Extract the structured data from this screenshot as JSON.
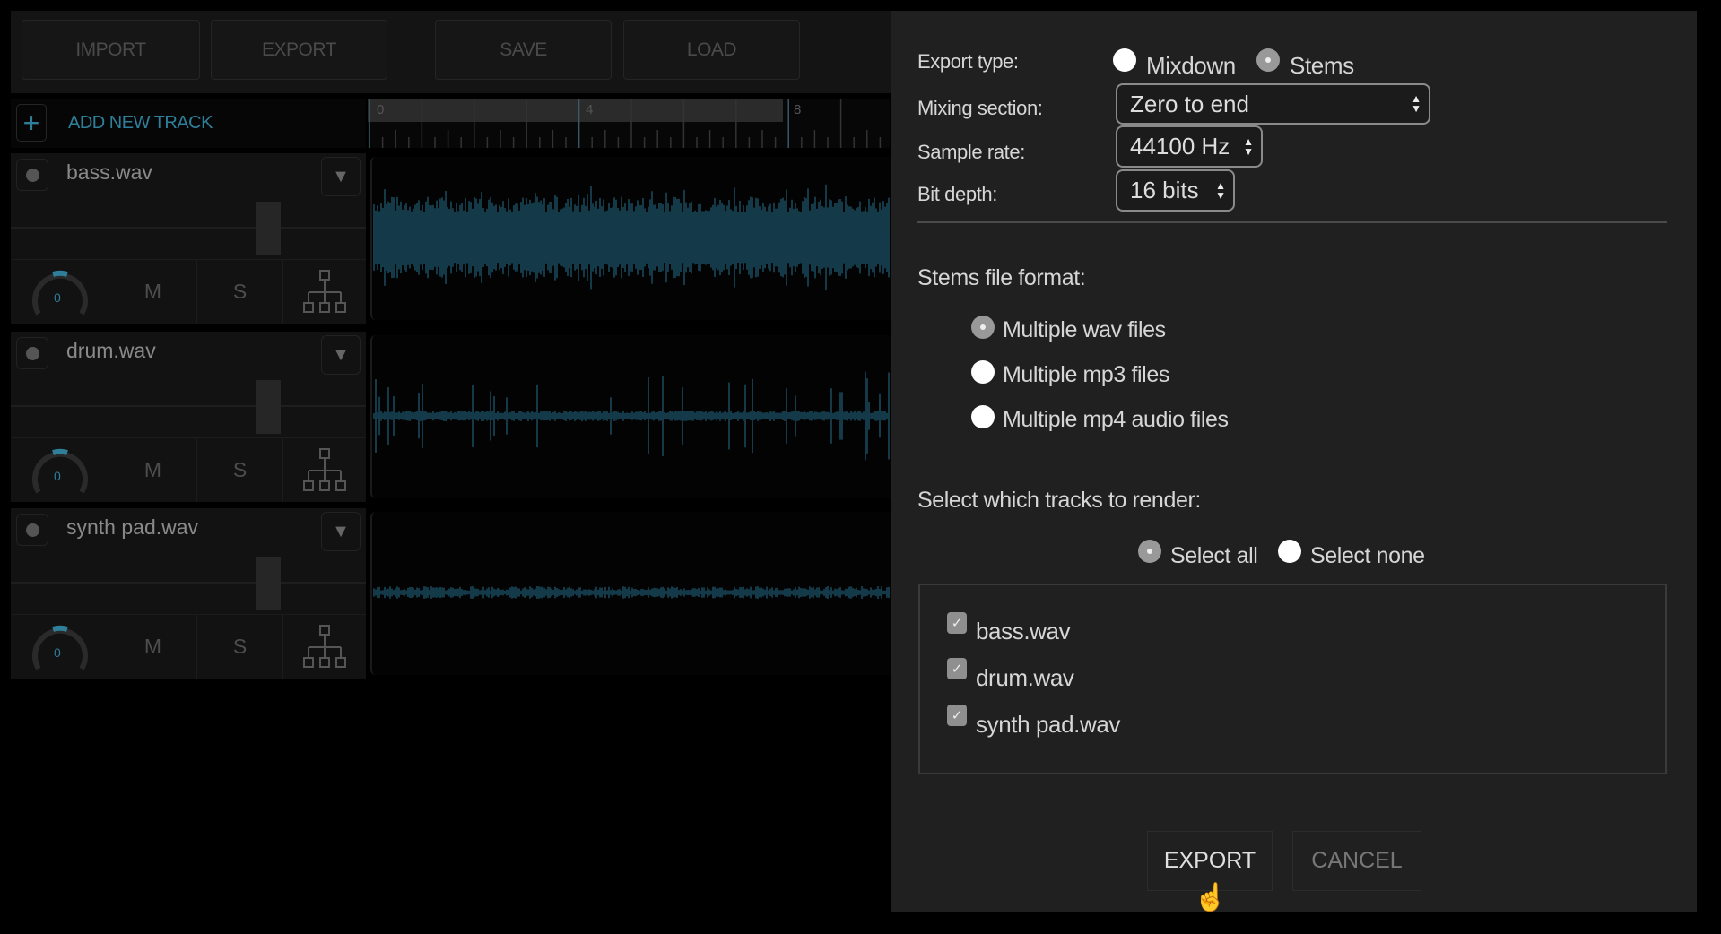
{
  "toolbar": {
    "import": "IMPORT",
    "export": "EXPORT",
    "save": "SAVE",
    "load": "LOAD"
  },
  "add_track": {
    "icon": "plus-icon",
    "label": "ADD NEW TRACK"
  },
  "timeline": {
    "markers": [
      "0",
      "4",
      "8"
    ]
  },
  "accent_color": "#2f7f9a",
  "tracks": [
    {
      "name": "bass.wav",
      "pan": "0",
      "mute": "M",
      "solo": "S"
    },
    {
      "name": "drum.wav",
      "pan": "0",
      "mute": "M",
      "solo": "S"
    },
    {
      "name": "synth pad.wav",
      "pan": "0",
      "mute": "M",
      "solo": "S"
    }
  ],
  "dialog": {
    "export_type_label": "Export type:",
    "export_types": [
      {
        "label": "Mixdown",
        "selected": false
      },
      {
        "label": "Stems",
        "selected": true
      }
    ],
    "mixing_section_label": "Mixing section:",
    "mixing_section_value": "Zero to end",
    "sample_rate_label": "Sample rate:",
    "sample_rate_value": "44100 Hz",
    "bit_depth_label": "Bit depth:",
    "bit_depth_value": "16 bits",
    "stems_format_label": "Stems file format:",
    "stems_formats": [
      {
        "label": "Multiple wav files",
        "selected": true
      },
      {
        "label": "Multiple mp3 files",
        "selected": false
      },
      {
        "label": "Multiple mp4 audio files",
        "selected": false
      }
    ],
    "tracks_label": "Select which tracks to render:",
    "select_all": "Select all",
    "select_none": "Select none",
    "track_checks": [
      {
        "label": "bass.wav",
        "checked": true
      },
      {
        "label": "drum.wav",
        "checked": true
      },
      {
        "label": "synth pad.wav",
        "checked": true
      }
    ],
    "export_button": "EXPORT",
    "cancel_button": "CANCEL"
  }
}
